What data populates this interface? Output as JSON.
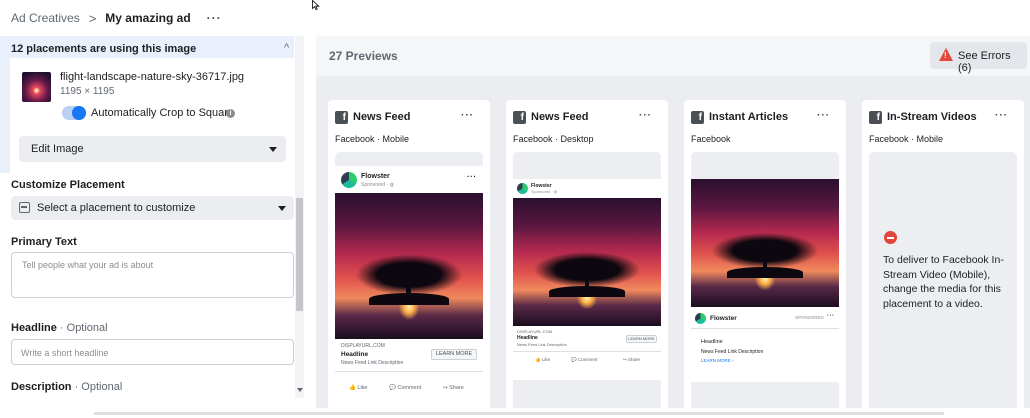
{
  "breadcrumb": {
    "parent": "Ad Creatives",
    "separator": ">",
    "current": "My amazing ad",
    "more": "···"
  },
  "left_panel": {
    "placements_header": "12 placements are using this image",
    "collapse_glyph": "^",
    "file_name": "flight-landscape-nature-sky-36717.jpg",
    "file_dims": "1195 × 1195",
    "auto_crop_label": "Automatically Crop to Square",
    "auto_crop_enabled": true,
    "info_glyph": "i",
    "edit_image_label": "Edit Image",
    "customize_label": "Customize Placement",
    "select_placement_label": "Select a placement to customize",
    "primary_text_label": "Primary Text",
    "primary_text_placeholder": "Tell people what your ad is about",
    "headline_label": "Headline",
    "headline_optional": " · Optional",
    "headline_placeholder": "Write a short headline",
    "description_label": "Description",
    "description_optional": " · Optional"
  },
  "previews": {
    "title": "27 Previews",
    "errors_label": "See Errors (6)",
    "cards": [
      {
        "title": "News Feed",
        "subtitle": "Facebook · Mobile"
      },
      {
        "title": "News Feed",
        "subtitle": "Facebook · Desktop"
      },
      {
        "title": "Instant Articles",
        "subtitle": "Facebook"
      },
      {
        "title": "In-Stream Videos",
        "subtitle": "Facebook · Mobile"
      }
    ],
    "more_glyph": "···",
    "fb_glyph": "f",
    "ad": {
      "brand": "Flowster",
      "sponsored": "Sponsored · ◍",
      "display_url": "DISPLAYURL.COM",
      "headline": "Headline",
      "description": "News Feed Link Description",
      "cta": "LEARN MORE",
      "like": "Like",
      "comment": "Comment",
      "share": "Share",
      "ia_meta": "SPONSORED",
      "ia_link_desc": "News Feed Link Description",
      "ia_cta": "LEARN MORE ›"
    },
    "instream_message": "To deliver to Facebook In-Stream Video (Mobile), change the media for this placement to a video."
  },
  "colors": {
    "accent": "#1877f2",
    "error": "#e0463b",
    "panel_bg": "#ebedf0",
    "selected_bg": "#e9f0fb"
  }
}
